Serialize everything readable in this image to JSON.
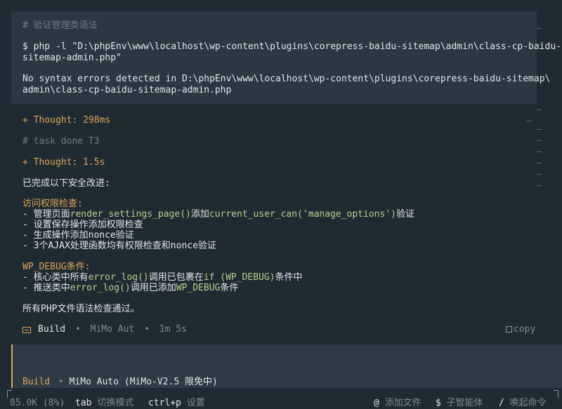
{
  "code_block": {
    "comment": "# 验证管理类语法",
    "cmd_line1": "$ php -l \"D:\\phpEnv\\www\\localhost\\wp-content\\plugins\\corepress-baidu-sitemap\\admin\\class-cp-baidu-",
    "cmd_line2": "sitemap-admin.php\"",
    "out_line1": "No syntax errors detected in D:\\phpEnv\\www\\localhost\\wp-content\\plugins\\corepress-baidu-sitemap\\",
    "out_line2": "admin\\class-cp-baidu-sitemap-admin.php"
  },
  "thought1": "+ Thought: 298ms",
  "task_done": "# task done T3",
  "thought2": "+ Thought: 1.5s",
  "summary_intro": "已完成以下安全改进:",
  "section_access": {
    "title": "访问权限检查:",
    "item1_pre": "- 管理页面",
    "item1_code1": "render_settings_page()",
    "item1_mid": "添加",
    "item1_code2": "current_user_can('manage_options')",
    "item1_post": "验证",
    "item2": "- 设置保存操作添加权限检查",
    "item3": "- 生成操作添加nonce验证",
    "item4": "- 3个AJAX处理函数均有权限检查和nonce验证"
  },
  "section_debug": {
    "title": "WP_DEBUG条件:",
    "item1_pre": "- 核心类中所有",
    "item1_code1": "error_log()",
    "item1_mid": "调用已包裹在",
    "item1_code2": "if (WP_DEBUG)",
    "item1_post": "条件中",
    "item2_pre": "- 推送类中",
    "item2_code1": "error_log()",
    "item2_mid": "调用已添加",
    "item2_code2": "WP_DEBUG",
    "item2_post": "条件"
  },
  "final_note": "所有PHP文件语法检查通过。",
  "build_status": {
    "label": "Build",
    "sep1": "•",
    "model": "MiMo Aut",
    "sep2": "•",
    "time": "1m 5s",
    "copy_label": "copy"
  },
  "input": {
    "mode_label": "Build",
    "sep": "•",
    "model_label": "MiMo Auto (MiMo-V2.5 限免中)"
  },
  "status_bar": {
    "tokens": "85.0K (8%)",
    "tab_key": "tab",
    "tab_action": "切换模式",
    "ctrl_key": "ctrl+p",
    "ctrl_action": "设置",
    "at_key": "@",
    "at_action": "添加文件",
    "dollar_key": "$",
    "dollar_action": "子智能体",
    "slash_key": "/",
    "slash_action": "唤起命令"
  },
  "colors": {
    "background": "#1f2b33",
    "code_block": "#293841",
    "accent_orange": "#e0a35a",
    "code_green": "#b9cf8c"
  }
}
